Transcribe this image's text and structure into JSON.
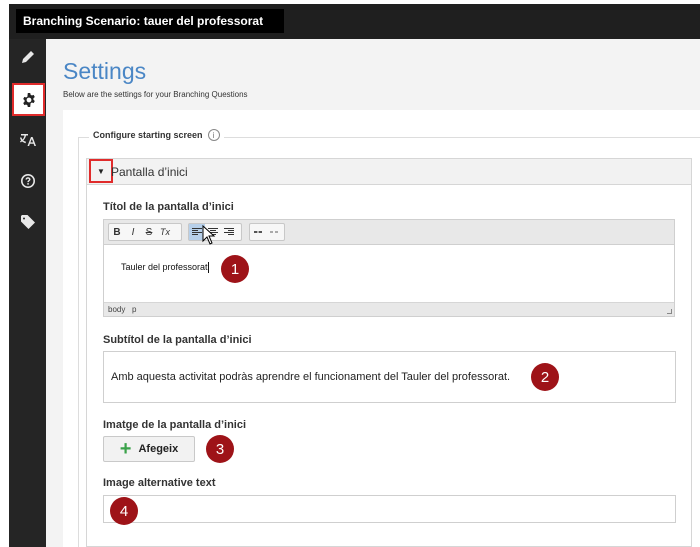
{
  "window": {
    "title": "Branching Scenario: tauer del professorat"
  },
  "sidebar": {
    "items": [
      {
        "icon": "pencil-icon",
        "active": false
      },
      {
        "icon": "gear-icon",
        "active": true
      },
      {
        "icon": "translate-icon",
        "active": false
      },
      {
        "icon": "help-icon",
        "active": false
      },
      {
        "icon": "tag-icon",
        "active": false
      }
    ]
  },
  "settings": {
    "title": "Settings",
    "description": "Below are the settings for your Branching Questions",
    "section_legend": "Configure starting screen",
    "group_label": "Pantalla d’inici",
    "title_field_label": "Títol de la pantalla d’inici",
    "title_value": "Tauler del professorat",
    "editor_path": [
      "body",
      "p"
    ],
    "toolbar": {
      "bold": "B",
      "italic": "I",
      "strike": "S",
      "clear": "Tx"
    },
    "subtitle_label": "Subtítol de la pantalla d’inici",
    "subtitle_value": "Amb aquesta activitat podràs aprendre el funcionament del Tauler del professorat.",
    "image_label": "Imatge de la pantalla d’inici",
    "add_button": "Afegeix",
    "alt_text_label": "Image alternative text",
    "alt_text_value": ""
  },
  "annotations": [
    "1",
    "2",
    "3",
    "4"
  ],
  "colors": {
    "accent_title": "#4a86c5",
    "highlight_border": "#e02b2b",
    "badge": "#9e1318",
    "add_icon": "#3aa24a"
  }
}
